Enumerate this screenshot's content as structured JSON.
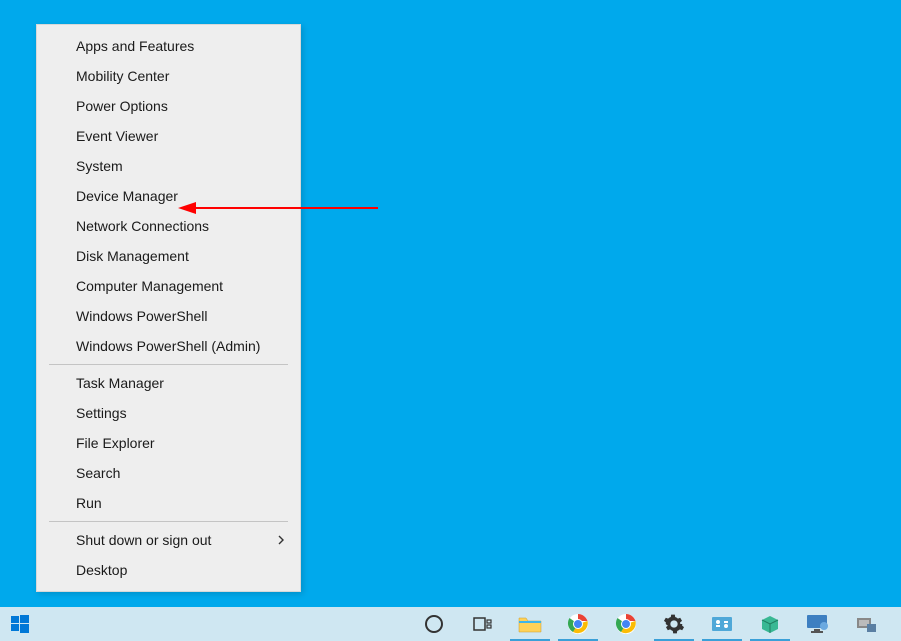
{
  "menu": {
    "items_group1": [
      {
        "label": "Apps and Features",
        "name": "menu-item-apps-and-features"
      },
      {
        "label": "Mobility Center",
        "name": "menu-item-mobility-center"
      },
      {
        "label": "Power Options",
        "name": "menu-item-power-options"
      },
      {
        "label": "Event Viewer",
        "name": "menu-item-event-viewer"
      },
      {
        "label": "System",
        "name": "menu-item-system"
      },
      {
        "label": "Device Manager",
        "name": "menu-item-device-manager"
      },
      {
        "label": "Network Connections",
        "name": "menu-item-network-connections"
      },
      {
        "label": "Disk Management",
        "name": "menu-item-disk-management"
      },
      {
        "label": "Computer Management",
        "name": "menu-item-computer-management"
      },
      {
        "label": "Windows PowerShell",
        "name": "menu-item-windows-powershell"
      },
      {
        "label": "Windows PowerShell (Admin)",
        "name": "menu-item-windows-powershell-admin"
      }
    ],
    "items_group2": [
      {
        "label": "Task Manager",
        "name": "menu-item-task-manager"
      },
      {
        "label": "Settings",
        "name": "menu-item-settings"
      },
      {
        "label": "File Explorer",
        "name": "menu-item-file-explorer"
      },
      {
        "label": "Search",
        "name": "menu-item-search"
      },
      {
        "label": "Run",
        "name": "menu-item-run"
      }
    ],
    "items_group3": [
      {
        "label": "Shut down or sign out",
        "name": "menu-item-shut-down-or-sign-out",
        "submenu": true
      },
      {
        "label": "Desktop",
        "name": "menu-item-desktop"
      }
    ]
  },
  "annotation": {
    "points_to": "Device Manager",
    "color": "#ff0000"
  },
  "taskbar": {
    "background": "#cfe7f2",
    "items": [
      {
        "name": "start-button",
        "icon": "windows"
      },
      {
        "name": "cortana-search-button",
        "icon": "circle"
      },
      {
        "name": "task-view-button",
        "icon": "taskview"
      },
      {
        "name": "file-explorer-taskbar",
        "icon": "explorer",
        "active": true
      },
      {
        "name": "chrome-taskbar-1",
        "icon": "chrome",
        "active": true
      },
      {
        "name": "chrome-taskbar-2",
        "icon": "chrome"
      },
      {
        "name": "settings-taskbar",
        "icon": "gear",
        "active": true
      },
      {
        "name": "control-panel-taskbar",
        "icon": "controlpanel",
        "active": true
      },
      {
        "name": "programs-and-features-taskbar",
        "icon": "box",
        "active": true
      },
      {
        "name": "virtual-box-taskbar",
        "icon": "monitor"
      },
      {
        "name": "generic-app-taskbar",
        "icon": "generic"
      }
    ]
  }
}
